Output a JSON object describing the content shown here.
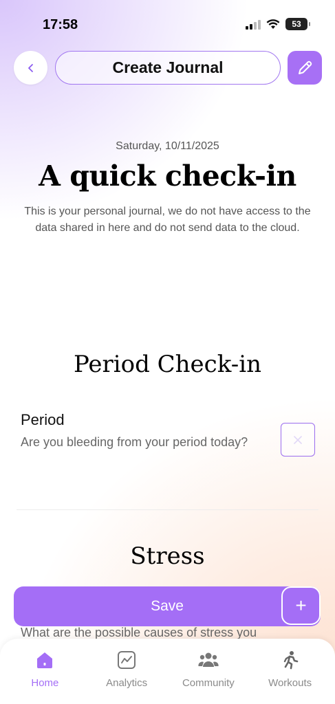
{
  "status_bar": {
    "time": "17:58",
    "battery": "53"
  },
  "header": {
    "title": "Create Journal",
    "back_icon": "chevron-left-icon",
    "edit_icon": "pencil-icon"
  },
  "intro": {
    "date": "Saturday, 10/11/2025",
    "title": "A quick check-in",
    "description": "This is your personal journal, we do not have access to the data shared in here and do not send data to the cloud."
  },
  "period_section": {
    "title": "Period Check-in",
    "question_label": "Period",
    "question_text": "Are you bleeding from your period today?",
    "checked": false
  },
  "stress_section": {
    "title": "Stress",
    "partial_text": "What are the possible causes of stress you"
  },
  "actions": {
    "save_label": "Save",
    "plus_label": "+"
  },
  "tabs": [
    {
      "label": "Home",
      "icon": "home-icon",
      "active": true
    },
    {
      "label": "Analytics",
      "icon": "analytics-icon",
      "active": false
    },
    {
      "label": "Community",
      "icon": "community-icon",
      "active": false
    },
    {
      "label": "Workouts",
      "icon": "workouts-icon",
      "active": false
    }
  ],
  "colors": {
    "accent": "#a46ef6",
    "accent_border": "#a176f0"
  }
}
